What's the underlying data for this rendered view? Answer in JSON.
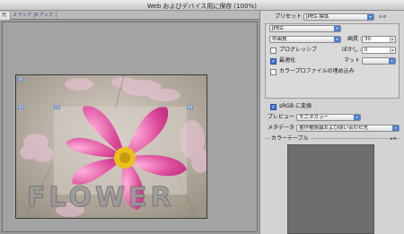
{
  "window": {
    "title": "Web およびデバイス用に保存 (100%)"
  },
  "tabs": [
    {
      "label": "元"
    },
    {
      "label": "2 アップ"
    },
    {
      "label": "4 アップ"
    }
  ],
  "image": {
    "text": "FLOWER",
    "slices": [
      "01",
      "02",
      "03",
      "04"
    ]
  },
  "panel": {
    "preset_label": "プリセット :",
    "preset_value": "JPEG 標準",
    "format_value": "JPEG",
    "quality_level_value": "中画質",
    "quality_label": "画質 :",
    "quality_value": "30",
    "progressive_label": "プログレッシブ",
    "progressive_checked": false,
    "blur_label": "ぼかし :",
    "blur_value": "0",
    "optimize_label": "最適化",
    "optimize_checked": true,
    "matte_label": "マット :",
    "matte_value": "",
    "icc_label": "カラープロファイルの埋め込み",
    "icc_checked": false,
    "srgb_label": "sRGB に変換",
    "srgb_checked": true,
    "preview_label": "プレビュー :",
    "preview_value": "モニタカラー",
    "metadata_label": "メタデータ :",
    "metadata_value": "著作権情報および問い合わせ先",
    "color_table_label": "カラーテーブル",
    "menu_icon": "panel-menu-icon"
  },
  "colors": {
    "accent": "#4a7fd1",
    "flower_pink": "#e0509f",
    "flower_center": "#e8c21a"
  }
}
